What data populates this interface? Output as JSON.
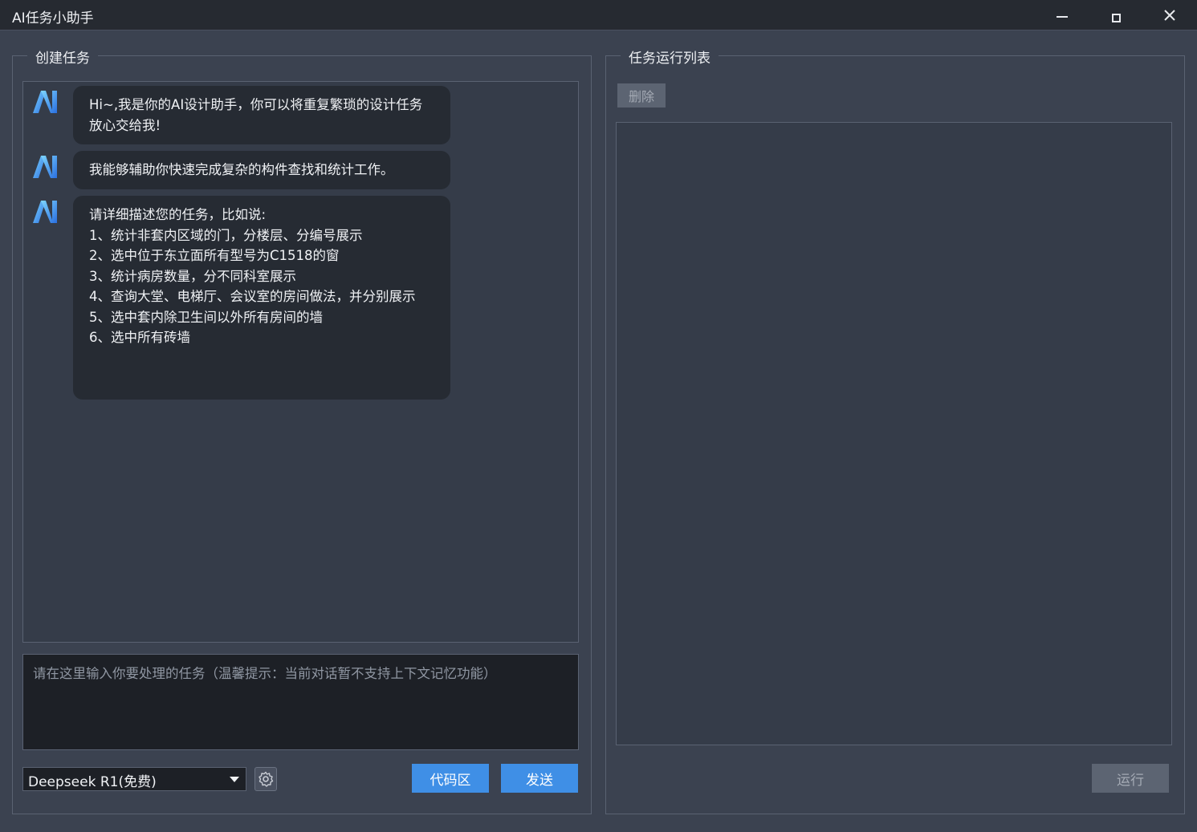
{
  "window": {
    "title": "AI任务小助手"
  },
  "create_task": {
    "legend": "创建任务",
    "messages": [
      {
        "text": "Hi~,我是你的AI设计助手，你可以将重复繁琐的设计任务放心交给我!"
      },
      {
        "text": "我能够辅助你快速完成复杂的构件查找和统计工作。"
      },
      {
        "text": "请详细描述您的任务，比如说:\n1、统计非套内区域的门，分楼层、分编号展示\n2、选中位于东立面所有型号为C1518的窗\n3、统计病房数量，分不同科室展示\n4、查询大堂、电梯厅、会议室的房间做法，并分别展示\n5、选中套内除卫生间以外所有房间的墙\n6、选中所有砖墙"
      }
    ],
    "input_placeholder": "请在这里输入你要处理的任务（温馨提示：当前对话暂不支持上下文记忆功能）",
    "model_selected": "Deepseek R1(免费)",
    "code_button": "代码区",
    "send_button": "发送"
  },
  "task_list": {
    "legend": "任务运行列表",
    "delete_button": "删除",
    "run_button": "运行"
  },
  "colors": {
    "accent": "#3f8fe6",
    "background": "#3b4250",
    "titlebar": "#262a31"
  }
}
